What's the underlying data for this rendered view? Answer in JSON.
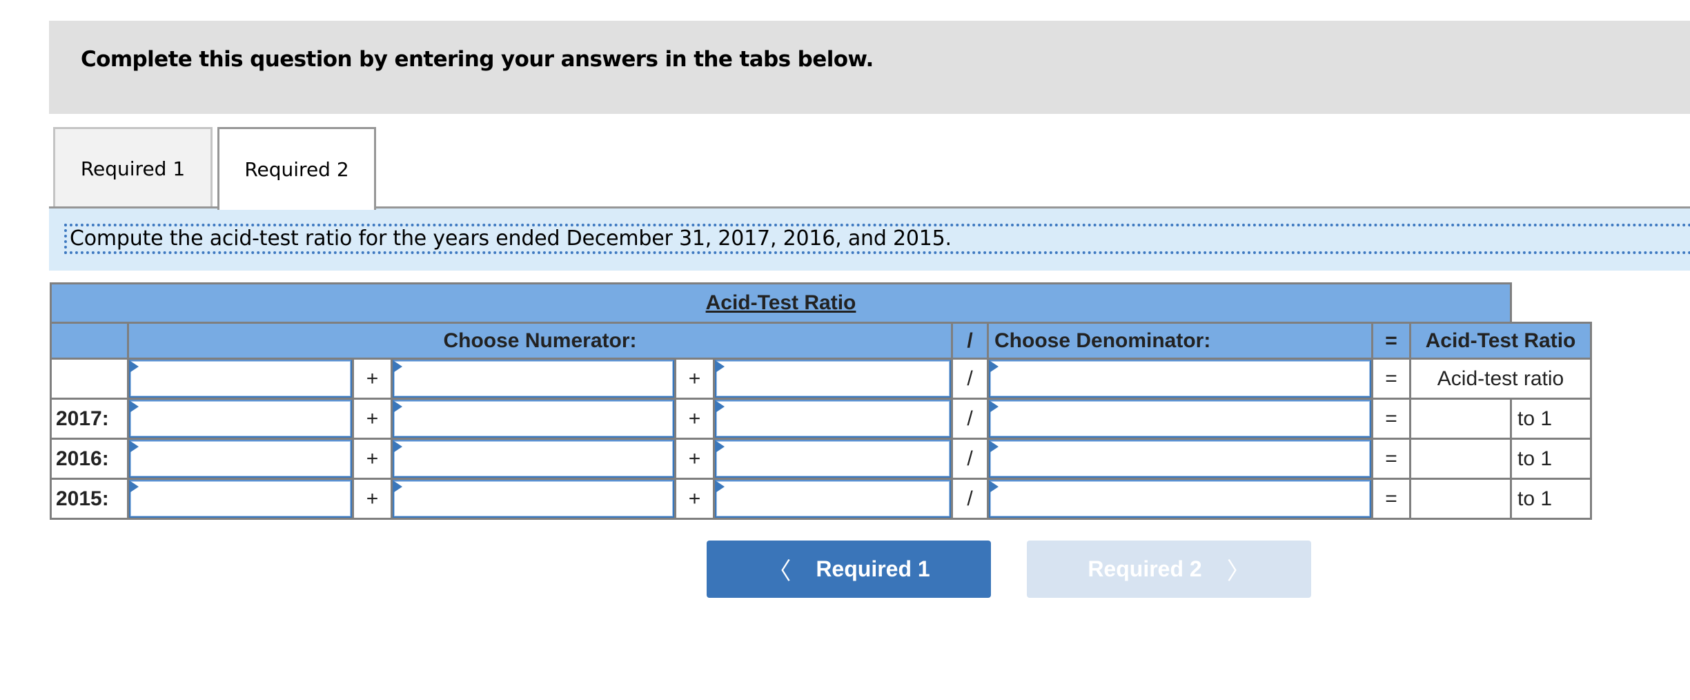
{
  "instructions": {
    "title": "Complete this question by entering your answers in the tabs below."
  },
  "tabs": [
    {
      "label": "Required 1",
      "active": false
    },
    {
      "label": "Required 2",
      "active": true
    }
  ],
  "prompt": "Compute the acid-test ratio for the years ended December 31, 2017, 2016, and 2015.",
  "table": {
    "title": "Acid-Test Ratio",
    "headers": {
      "numerator": "Choose Numerator:",
      "divide": "/",
      "denominator": "Choose Denominator:",
      "equals": "=",
      "result": "Acid-Test Ratio"
    },
    "operators": {
      "plus": "+",
      "divide": "/",
      "equals": "="
    },
    "label_row": {
      "result_label": "Acid-test ratio"
    },
    "rows": [
      {
        "year": "2017:",
        "suffix": "to 1"
      },
      {
        "year": "2016:",
        "suffix": "to 1"
      },
      {
        "year": "2015:",
        "suffix": "to 1"
      }
    ]
  },
  "navigation": {
    "prev_label": "Required 1",
    "next_label": "Required 2",
    "prev_icon": "chevron-left-icon",
    "next_icon": "chevron-right-icon",
    "chevron_left": "〈",
    "chevron_right": "〉"
  },
  "colors": {
    "header_bg": "#78abe3",
    "instructions_bg": "#e0e0e0",
    "prompt_bg": "#d9ebf9",
    "primary_button": "#3a75b9",
    "disabled_button": "#d7e3f1",
    "input_border": "#3a77bb"
  }
}
